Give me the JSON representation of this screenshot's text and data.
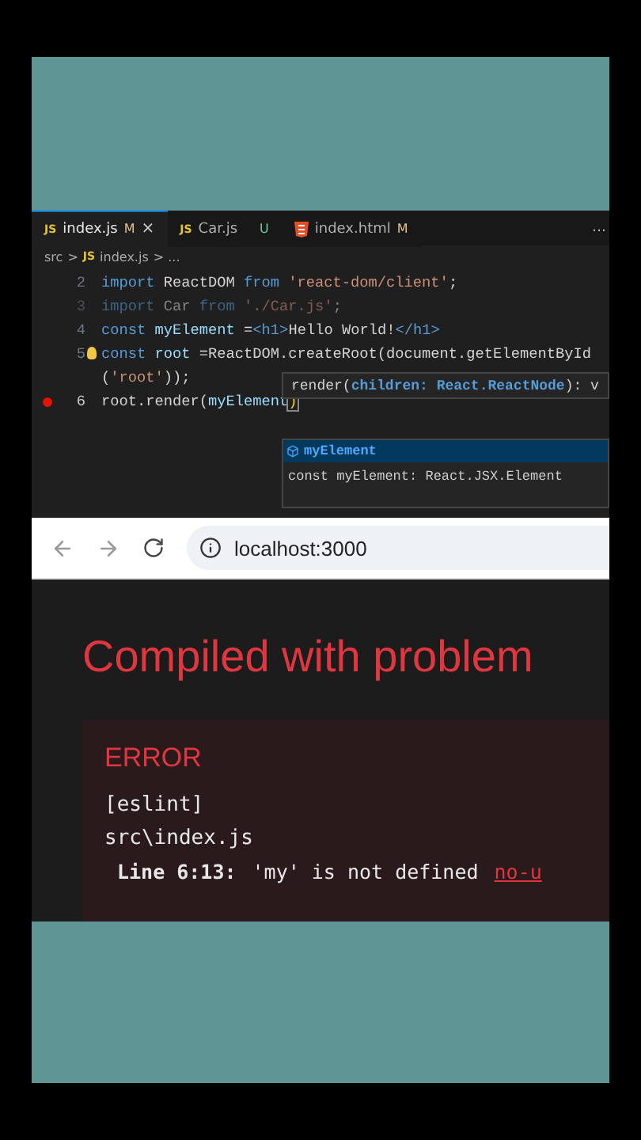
{
  "editor": {
    "tabs": [
      {
        "kind": "js",
        "icon_text": "JS",
        "label": "index.js",
        "badge": "M",
        "close": "×",
        "selected": true
      },
      {
        "kind": "js",
        "icon_text": "JS",
        "label": "Car.js",
        "badge": "U",
        "selected": false
      },
      {
        "kind": "html",
        "label": "index.html",
        "badge": "M",
        "selected": false
      }
    ],
    "more": "…",
    "breadcrumb": {
      "folder": "src",
      "separator": ">",
      "icon_text": "JS",
      "file": "index.js",
      "tail": "> ..."
    },
    "lines": [
      {
        "number": "2",
        "dim": false,
        "breakpoint": false,
        "tokens": [
          {
            "kind": "kw",
            "text": "import "
          },
          {
            "kind": "plain",
            "text": "ReactDOM "
          },
          {
            "kind": "kw",
            "text": "from "
          },
          {
            "kind": "str",
            "text": "'react-dom/client'"
          },
          {
            "kind": "plain",
            "text": ";"
          }
        ]
      },
      {
        "number": "3",
        "dim": true,
        "breakpoint": false,
        "tokens": [
          {
            "kind": "kw",
            "text": "import "
          },
          {
            "kind": "plain",
            "text": "Car "
          },
          {
            "kind": "kw",
            "text": "from "
          },
          {
            "kind": "str",
            "text": "'./Car.js'"
          },
          {
            "kind": "plain",
            "text": ";"
          }
        ]
      },
      {
        "number": "4",
        "dim": false,
        "breakpoint": false,
        "tokens": [
          {
            "kind": "kw",
            "text": "const "
          },
          {
            "kind": "var",
            "text": "myElement "
          },
          {
            "kind": "plain",
            "text": "="
          },
          {
            "kind": "tag",
            "text": "<h1>"
          },
          {
            "kind": "plain",
            "text": "Hello World!"
          },
          {
            "kind": "tag",
            "text": "</h1>"
          }
        ]
      },
      {
        "number": "5",
        "dim": false,
        "breakpoint": false,
        "bulb": true,
        "tokens": [
          {
            "kind": "kw",
            "text": "const "
          },
          {
            "kind": "var",
            "text": "root "
          },
          {
            "kind": "plain",
            "text": "=ReactDOM.createRoot(document.getElementById"
          }
        ]
      },
      {
        "dim": false,
        "breakpoint": false,
        "tokens": [
          {
            "kind": "plain",
            "text": "("
          },
          {
            "kind": "str",
            "text": "'root'"
          },
          {
            "kind": "plain",
            "text": "));"
          }
        ]
      },
      {
        "number": "6",
        "dim": false,
        "breakpoint": true,
        "tokens": [
          {
            "kind": "plain",
            "text": "root.render("
          },
          {
            "kind": "var",
            "text": "myElement"
          },
          {
            "kind": "bracket",
            "text": ")"
          }
        ]
      }
    ],
    "hover": {
      "name": "render(",
      "param": "children: React.ReactNode",
      "rest": "): v"
    },
    "suggest": {
      "items": [
        {
          "label": "myElement",
          "selected": true
        }
      ],
      "detail": "const myElement: React.JSX.Element"
    }
  },
  "browser": {
    "url": "localhost:3000",
    "title": "Compiled with problem",
    "error": {
      "heading": "ERROR",
      "lines": [
        "[eslint]",
        "src\\index.js"
      ],
      "detail": {
        "location": "Line 6:13:",
        "message": "'my' is not defined",
        "rule": "no-u"
      }
    }
  }
}
